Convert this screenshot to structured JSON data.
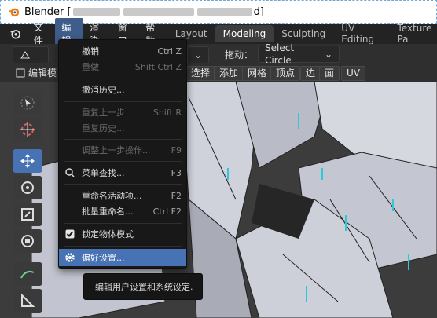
{
  "window": {
    "app_name": "Blender",
    "title_prefix": "Blender [",
    "title_suffix": "d]"
  },
  "topbar": {
    "menus": [
      "文件",
      "编辑",
      "渲染",
      "窗口",
      "帮助"
    ],
    "active_menu": "编辑",
    "workspace_tabs": [
      "Layout",
      "Modeling",
      "Sculpting",
      "UV Editing",
      "Texture Pa"
    ],
    "active_tab": "Modeling"
  },
  "toolbar": {
    "drag_label": "拖动：",
    "select_mode": "Select Circle",
    "mode_label": "编辑模"
  },
  "mode_buttons": [
    "选择",
    "添加",
    "网格",
    "顶点",
    "边",
    "面",
    "UV"
  ],
  "edit_menu": {
    "items": [
      {
        "label": "撤销",
        "shortcut": "Ctrl Z",
        "disabled": false
      },
      {
        "label": "重做",
        "shortcut": "Shift Ctrl Z",
        "disabled": true
      },
      {
        "label": "撤消历史...",
        "shortcut": "",
        "disabled": false
      },
      {
        "label": "重复上一步",
        "shortcut": "Shift R",
        "disabled": true
      },
      {
        "label": "重复历史...",
        "shortcut": "",
        "disabled": true
      },
      {
        "label": "调整上一步操作...",
        "shortcut": "F9",
        "disabled": true
      },
      {
        "label": "菜单查找...",
        "shortcut": "F3",
        "disabled": false
      },
      {
        "label": "重命名活动项...",
        "shortcut": "F2",
        "disabled": false
      },
      {
        "label": "批量重命名...",
        "shortcut": "Ctrl F2",
        "disabled": false
      },
      {
        "label": "锁定物体模式",
        "shortcut": "",
        "disabled": false,
        "checked": true
      },
      {
        "label": "偏好设置...",
        "shortcut": "",
        "disabled": false,
        "highlighted": true
      }
    ]
  },
  "tooltip": {
    "text": "编辑用户设置和系统设定."
  },
  "colors": {
    "accent": "#4772b3",
    "menu_bg": "#181818",
    "topbar_bg": "#232323"
  }
}
